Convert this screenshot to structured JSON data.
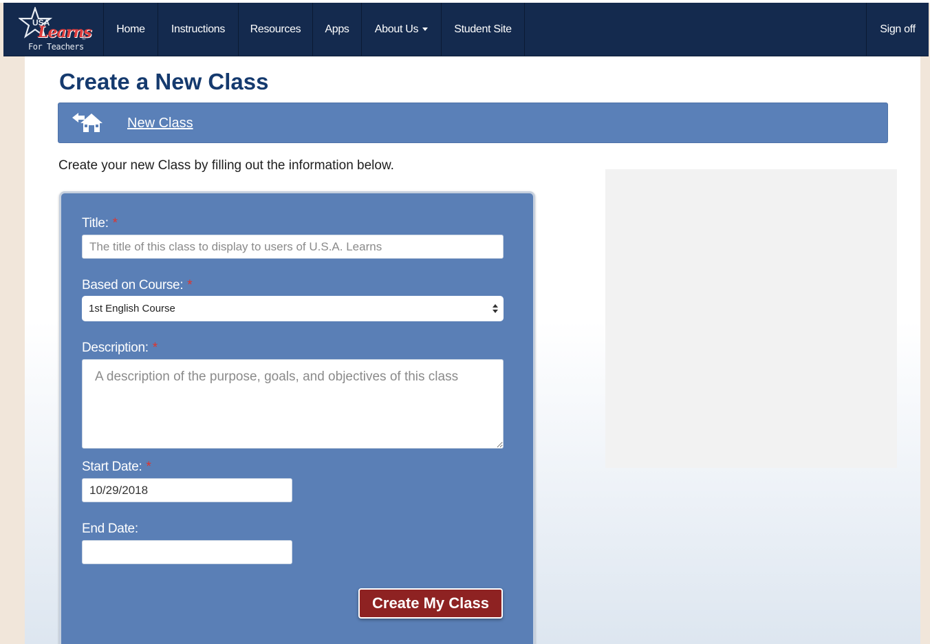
{
  "brand": {
    "logo_top": "USA",
    "logo_word": "Learns",
    "logo_reg": "®",
    "logo_sub": "For Teachers"
  },
  "nav": {
    "items": [
      {
        "label": "Home"
      },
      {
        "label": "Instructions"
      },
      {
        "label": "Resources"
      },
      {
        "label": "Apps"
      },
      {
        "label": "About Us",
        "has_dropdown": true
      },
      {
        "label": "Student Site"
      }
    ],
    "sign_off": "Sign off"
  },
  "page": {
    "title": "Create a New Class",
    "breadcrumb": {
      "icon": "back-home-icon",
      "link": "New Class"
    },
    "intro": "Create your new Class by filling out the information below."
  },
  "form": {
    "required_mark": "*",
    "title": {
      "label": "Title:",
      "placeholder": "The title of this class to display to users of U.S.A. Learns",
      "value": ""
    },
    "course": {
      "label": "Based on Course:",
      "selected": "1st English Course"
    },
    "description": {
      "label": "Description:",
      "placeholder": "A description of the purpose, goals, and objectives of this class",
      "value": ""
    },
    "start_date": {
      "label": "Start Date:",
      "value": "10/29/2018"
    },
    "end_date": {
      "label": "End Date:",
      "value": ""
    },
    "submit_label": "Create My Class"
  },
  "colors": {
    "navbar": "#142a4e",
    "title": "#153a6e",
    "panel": "#5a7fb6",
    "required": "#e0342c",
    "submit": "#8e2222"
  }
}
